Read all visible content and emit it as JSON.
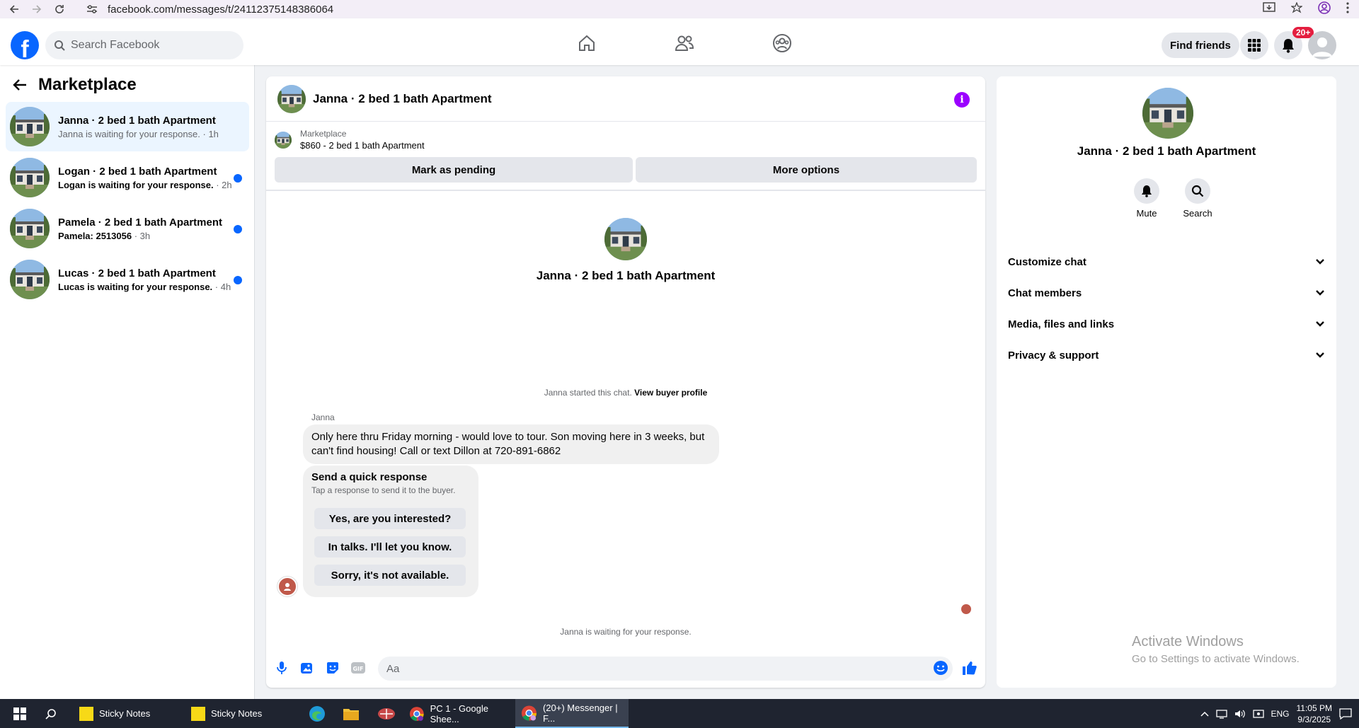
{
  "browser": {
    "url": "facebook.com/messages/t/24112375148386064"
  },
  "header": {
    "logo": "f",
    "search_placeholder": "Search Facebook",
    "find_friends": "Find friends",
    "notif_badge": "20+",
    "nav_icons": [
      "home-icon",
      "friends-icon",
      "groups-icon"
    ]
  },
  "sidebar": {
    "title": "Marketplace",
    "conversations": [
      {
        "name": "Janna · 2 bed 1 bath Apartment",
        "preview": "Janna is waiting for your response.",
        "time": "· 1h",
        "unread": false
      },
      {
        "name": "Logan · 2 bed 1 bath Apartment",
        "preview": "Logan is waiting for your response.",
        "time": "· 2h",
        "unread": true
      },
      {
        "name": "Pamela · 2 bed 1 bath Apartment",
        "preview": "Pamela: 2513056",
        "time": "· 3h",
        "unread": true
      },
      {
        "name": "Lucas · 2 bed 1 bath Apartment",
        "preview": "Lucas is waiting for your response.",
        "time": "· 4h",
        "unread": true
      }
    ]
  },
  "chat": {
    "title": "Janna · 2 bed 1 bath Apartment",
    "marketplace_label": "Marketplace",
    "listing": "$860 - 2 bed 1 bath Apartment",
    "mark_pending": "Mark as pending",
    "more_options": "More options",
    "intro_name": "Janna · 2 bed 1 bath Apartment",
    "started_text": "Janna started this chat.",
    "view_profile": "View buyer profile",
    "sender": "Janna",
    "message": "Only here thru Friday morning - would love to tour.  Son moving here in 3 weeks, but can't find housing!  Call or text Dillon at 720-891-6862",
    "quick_title": "Send a quick response",
    "quick_sub": "Tap a response to send it to the buyer.",
    "quick_options": [
      "Yes, are you interested?",
      "In talks. I'll let you know.",
      "Sorry, it's not available."
    ],
    "waiting": "Janna is waiting for your response.",
    "input_placeholder": "Aa"
  },
  "right_panel": {
    "name": "Janna · 2 bed 1 bath Apartment",
    "mute": "Mute",
    "search": "Search",
    "sections": [
      "Customize chat",
      "Chat members",
      "Media, files and links",
      "Privacy & support"
    ]
  },
  "watermark": {
    "line1": "Activate Windows",
    "line2": "Go to Settings to activate Windows."
  },
  "taskbar": {
    "apps": [
      "Sticky Notes",
      "Sticky Notes",
      "PC 1 - Google Shee...",
      "(20+) Messenger | F..."
    ],
    "lang": "ENG",
    "time": "11:05 PM",
    "date": "9/3/2025"
  },
  "colors": {
    "fb_blue": "#0866ff",
    "unread_dot": "#0866ff",
    "active_conv": "#ebf5ff",
    "info_purple": "#9b00ff",
    "badge_red": "#e41e3f"
  }
}
